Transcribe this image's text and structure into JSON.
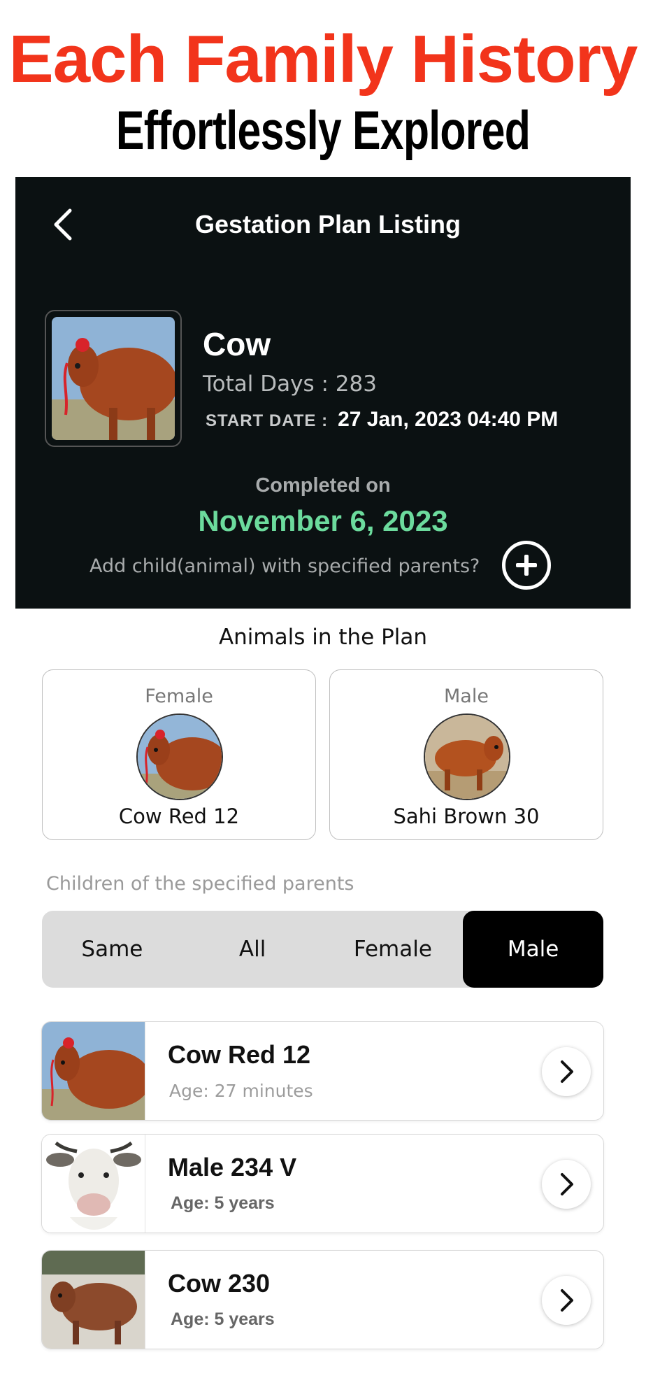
{
  "promo": {
    "title": "Each Family History",
    "subtitle": "Effortlessly Explored",
    "title_color": "#f2341b"
  },
  "header": {
    "back_icon": "chevron-left-icon",
    "title": "Gestation Plan Listing"
  },
  "plan": {
    "animal_name": "Cow",
    "total_days": "Total Days : 283",
    "start_date_label": "START DATE :",
    "start_date_value": "27 Jan, 2023 04:40 PM",
    "completed_label": "Completed on",
    "completed_date": "November 6, 2023",
    "completed_color": "#6cdb9d",
    "add_child_text": "Add child(animal) with specified parents?",
    "add_icon": "plus-circle-icon"
  },
  "animals_section": {
    "title": "Animals in the Plan",
    "female": {
      "role": "Female",
      "name": "Cow Red 12"
    },
    "male": {
      "role": "Male",
      "name": "Sahi Brown 30"
    }
  },
  "children": {
    "label": "Children of the specified parents",
    "filters": [
      "Same",
      "All",
      "Female",
      "Male"
    ],
    "active_filter": "Male",
    "items": [
      {
        "name": "Cow Red 12",
        "age": "Age: 27 minutes"
      },
      {
        "name": "Male 234 V",
        "age": "Age: 5 years"
      },
      {
        "name": "Cow 230",
        "age": "Age: 5 years"
      }
    ]
  }
}
